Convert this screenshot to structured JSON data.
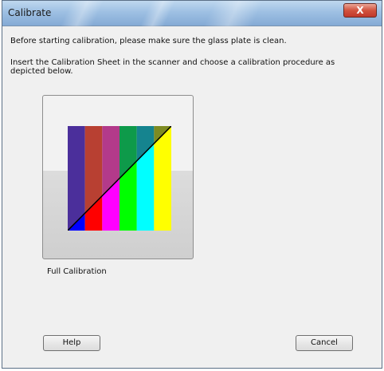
{
  "window": {
    "title": "Calibrate",
    "close_label": "X"
  },
  "content": {
    "info_line1": "Before starting calibration, please make sure the glass plate is clean.",
    "info_line2": "Insert the Calibration Sheet in the scanner and choose a calibration procedure as depicted below."
  },
  "calibration": {
    "option_label": "Full Calibration",
    "bar_colors": [
      "#4b2f9b",
      "#b84032",
      "#b33a8a",
      "#0e9a4a",
      "#15848f",
      "#7e8b22"
    ],
    "lower_colors": [
      "#0000ff",
      "#ff0000",
      "#ff00ff",
      "#00ff00",
      "#00ffff",
      "#ffff00"
    ]
  },
  "buttons": {
    "help_label": "Help",
    "cancel_label": "Cancel"
  }
}
